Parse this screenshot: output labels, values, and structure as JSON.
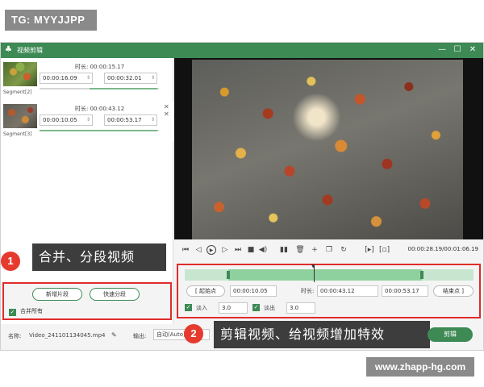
{
  "badge": {
    "tg": "TG: MYYJJPP"
  },
  "window": {
    "title": "视频剪辑",
    "min": "—",
    "max": "☐",
    "close": "✕"
  },
  "segments": [
    {
      "name": "Segment[2]",
      "duration_label": "时长:",
      "duration": "00:00:15.17",
      "start": "00:00:16.09",
      "end": "00:00:32.01"
    },
    {
      "name": "Segment[3]",
      "duration_label": "时长:",
      "duration": "00:00:43.12",
      "start": "00:00:10.05",
      "end": "00:00:53.17"
    }
  ],
  "player": {
    "time": "00:00:28.19/00:01:06.19"
  },
  "edit": {
    "start_label": "起始点",
    "start": "00:00:10.05",
    "duration_label": "时长:",
    "duration": "00:00:43.12",
    "end": "00:00:53.17",
    "end_label": "结束点",
    "fade_in_label": "淡入",
    "fade_in": "3.0",
    "fade_out_label": "淡出",
    "fade_out": "3.0"
  },
  "merge": {
    "add_segment": "新增片段",
    "quick_split": "快速分段",
    "merge_all": "合并所有"
  },
  "bottom": {
    "name_label": "名称:",
    "name_value": "Video_241101134045.mp4",
    "output_label": "输出:",
    "output_value": "自动(Auto)",
    "cut_button": "剪辑"
  },
  "overlays": {
    "step1_num": "1",
    "step1_text": "合并、分段视频",
    "step2_num": "2",
    "step2_text": "剪辑视频、给视频增加特效"
  },
  "watermark": "www.zhapp-hg.com"
}
